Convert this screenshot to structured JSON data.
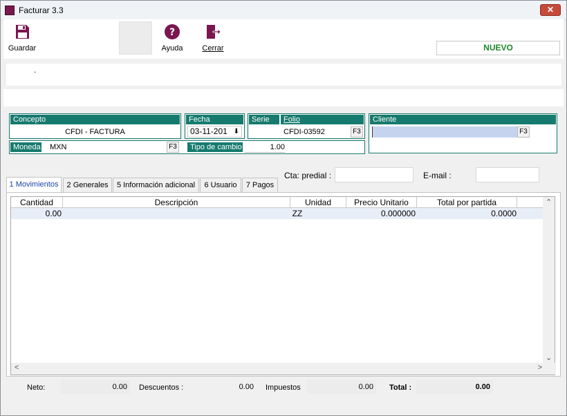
{
  "window": {
    "title": "Facturar 3.3",
    "close_label": "✕"
  },
  "toolbar": {
    "save_label": "Guardar",
    "help_label": "Ayuda",
    "close_label": "Cerrar",
    "status": "NUEVO",
    "status_color": "#1c8a2a",
    "save_icon": "floppy-disk-icon",
    "help_icon": "question-circle-icon",
    "exit_icon": "exit-door-icon"
  },
  "info": {
    "dot": "."
  },
  "concepto": {
    "header": "Concepto",
    "value": "CFDI - FACTURA"
  },
  "fecha": {
    "header": "Fecha",
    "value": "03-11-201",
    "dropdown_glyph": "⬇"
  },
  "serie_folio": {
    "serie_header": "Serie",
    "folio_header": "Folio",
    "folio_value": "CFDI-03592",
    "f3_label": "F3"
  },
  "cliente": {
    "header": "Cliente",
    "value": "",
    "f3_label": "F3"
  },
  "moneda": {
    "header": "Moneda",
    "value": "MXN",
    "f3_label": "F3"
  },
  "tipo_cambio": {
    "header": "Tipo de cambio",
    "value": "1.00"
  },
  "tabs": [
    {
      "label": "1 Movimientos"
    },
    {
      "label": "2 Generales"
    },
    {
      "label": "5 Información adicional"
    },
    {
      "label": "6 Usuario"
    },
    {
      "label": "7 Pagos"
    }
  ],
  "extra_fields": {
    "predial_label": "Cta: predial :",
    "email_label": "E-mail :"
  },
  "grid": {
    "columns": [
      "Cantidad",
      "Descripción",
      "Unidad",
      "Precio Unitario",
      "Total por partida"
    ],
    "rows": [
      {
        "cantidad": "0.00",
        "descripcion": "",
        "unidad": "ZZ",
        "precio": "0.000000",
        "total": "0.0000"
      }
    ]
  },
  "totals": {
    "neto_label": "Neto:",
    "neto_value": "0.00",
    "descuentos_label": "Descuentos :",
    "descuentos_value": "0.00",
    "impuestos_label": "Impuestos",
    "impuestos_value": "0.00",
    "total_label": "Total :",
    "total_value": "0.00"
  },
  "colors": {
    "accent": "#177a6e",
    "brand": "#7a1650",
    "highlight_field": "#c5d3ef",
    "row_selected": "#e8eef8"
  }
}
